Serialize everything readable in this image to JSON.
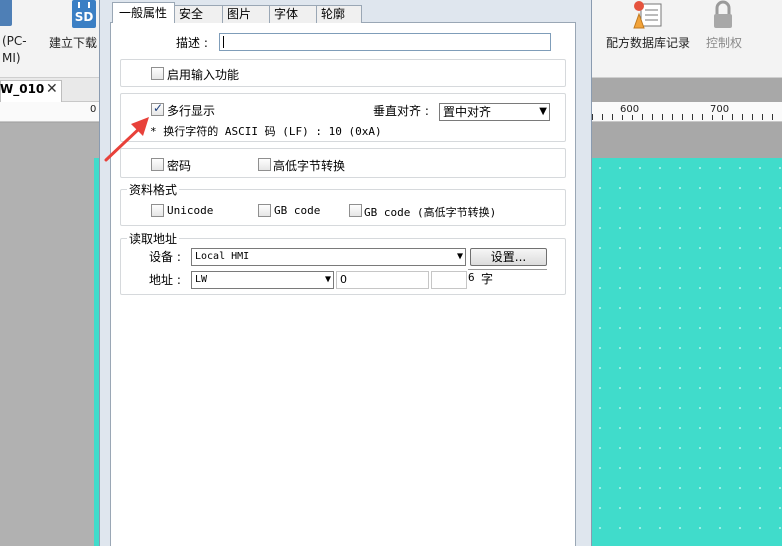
{
  "ribbon": {
    "left_label_line1": "(PC-",
    "left_label_line2": "MI)",
    "build_download": "建立下载",
    "sd_icon_text": "SD",
    "recipe_db": "配方数据库记录",
    "control": "控制权"
  },
  "doc_tab": {
    "label": "W_010",
    "close": "✕"
  },
  "ruler": {
    "left_tick": "0",
    "tick_600": "600",
    "tick_700": "700"
  },
  "dialog": {
    "tabs": [
      "一般属性",
      "安全",
      "图片",
      "字体",
      "轮廓"
    ],
    "description_label": "描述 :",
    "description_value": "",
    "enable_input": {
      "label": "启用输入功能",
      "checked": false
    },
    "multiline": {
      "label": "多行显示",
      "checked": true,
      "valign_label": "垂直对齐 :",
      "valign_value": "置中对齐",
      "note": "* 换行字符的 ASCII 码 (LF) : 10 (0xA)"
    },
    "password": {
      "label": "密码",
      "checked": false
    },
    "swap_bytes": {
      "label": "高低字节转换",
      "checked": false
    },
    "data_format": {
      "title": "资料格式",
      "options": [
        {
          "label": "Unicode",
          "checked": false
        },
        {
          "label": "GB code",
          "checked": false
        },
        {
          "label": "GB code (高低字节转换)",
          "checked": false
        }
      ]
    },
    "read_address": {
      "title": "读取地址",
      "device_label": "设备 :",
      "device_value": "Local HMI",
      "settings_button": "设置...",
      "address_label": "地址 :",
      "address_type": "LW",
      "address_value": "0",
      "length_value": "6",
      "length_unit": "字"
    }
  },
  "colors": {
    "canvas": "#40dccb",
    "arrow": "#e8413a"
  }
}
